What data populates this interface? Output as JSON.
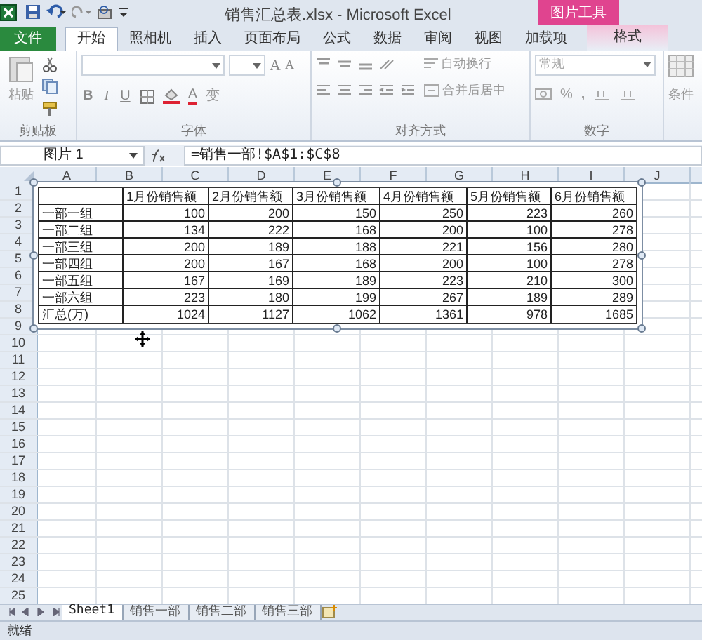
{
  "window": {
    "title": "销售汇总表.xlsx - Microsoft Excel"
  },
  "contextual_tab_group": {
    "title": "图片工具"
  },
  "ribbon_tabs": [
    {
      "label": "文件",
      "kind": "file",
      "selected": false
    },
    {
      "label": "开始",
      "kind": "normal",
      "selected": true
    },
    {
      "label": "照相机",
      "kind": "normal",
      "selected": false
    },
    {
      "label": "插入",
      "kind": "normal",
      "selected": false
    },
    {
      "label": "页面布局",
      "kind": "normal",
      "selected": false
    },
    {
      "label": "公式",
      "kind": "normal",
      "selected": false
    },
    {
      "label": "数据",
      "kind": "normal",
      "selected": false
    },
    {
      "label": "审阅",
      "kind": "normal",
      "selected": false
    },
    {
      "label": "视图",
      "kind": "normal",
      "selected": false
    },
    {
      "label": "加载项",
      "kind": "normal",
      "selected": false
    },
    {
      "label": "格式",
      "kind": "contextual",
      "selected": false
    }
  ],
  "ribbon": {
    "clipboard": {
      "paste": "粘贴",
      "label": "剪贴板"
    },
    "font": {
      "label": "字体",
      "bold": "B",
      "italic": "I",
      "underline": "U",
      "grow": "A",
      "shrink": "A",
      "font_color_button": "A",
      "phonetic": "变"
    },
    "alignment": {
      "label": "对齐方式",
      "wrap": "自动换行",
      "merge": "合并后居中"
    },
    "number": {
      "label": "数字",
      "format": "常规",
      "percent": "%",
      "comma": ","
    },
    "styles": {
      "conditional": "条件"
    }
  },
  "formula_bar": {
    "name_box": "图片 1",
    "formula": "=销售一部!$A$1:$C$8"
  },
  "columns": [
    "A",
    "B",
    "C",
    "D",
    "E",
    "F",
    "G",
    "H",
    "I",
    "J"
  ],
  "rows": [
    "1",
    "2",
    "3",
    "4",
    "5",
    "6",
    "7",
    "8",
    "9",
    "10",
    "11",
    "12",
    "13",
    "14",
    "15",
    "16",
    "17",
    "18",
    "19",
    "20",
    "21",
    "22",
    "23",
    "24",
    "25"
  ],
  "picture": {
    "selected": true,
    "rows": [
      [
        "",
        "1月份销售额",
        "2月份销售额",
        "3月份销售额",
        "4月份销售额",
        "5月份销售额",
        "6月份销售额"
      ],
      [
        "一部一组",
        "100",
        "200",
        "150",
        "250",
        "223",
        "260"
      ],
      [
        "一部二组",
        "134",
        "222",
        "168",
        "200",
        "100",
        "278"
      ],
      [
        "一部三组",
        "200",
        "189",
        "188",
        "221",
        "156",
        "280"
      ],
      [
        "一部四组",
        "200",
        "167",
        "168",
        "200",
        "100",
        "278"
      ],
      [
        "一部五组",
        "167",
        "169",
        "189",
        "223",
        "210",
        "300"
      ],
      [
        "一部六组",
        "223",
        "180",
        "199",
        "267",
        "189",
        "289"
      ],
      [
        "汇总(万)",
        "1024",
        "1127",
        "1062",
        "1361",
        "978",
        "1685"
      ]
    ]
  },
  "sheet_tabs": [
    {
      "label": "Sheet1",
      "selected": true
    },
    {
      "label": "销售一部",
      "selected": false
    },
    {
      "label": "销售二部",
      "selected": false
    },
    {
      "label": "销售三部",
      "selected": false
    }
  ],
  "status_bar": {
    "text": "就绪"
  }
}
